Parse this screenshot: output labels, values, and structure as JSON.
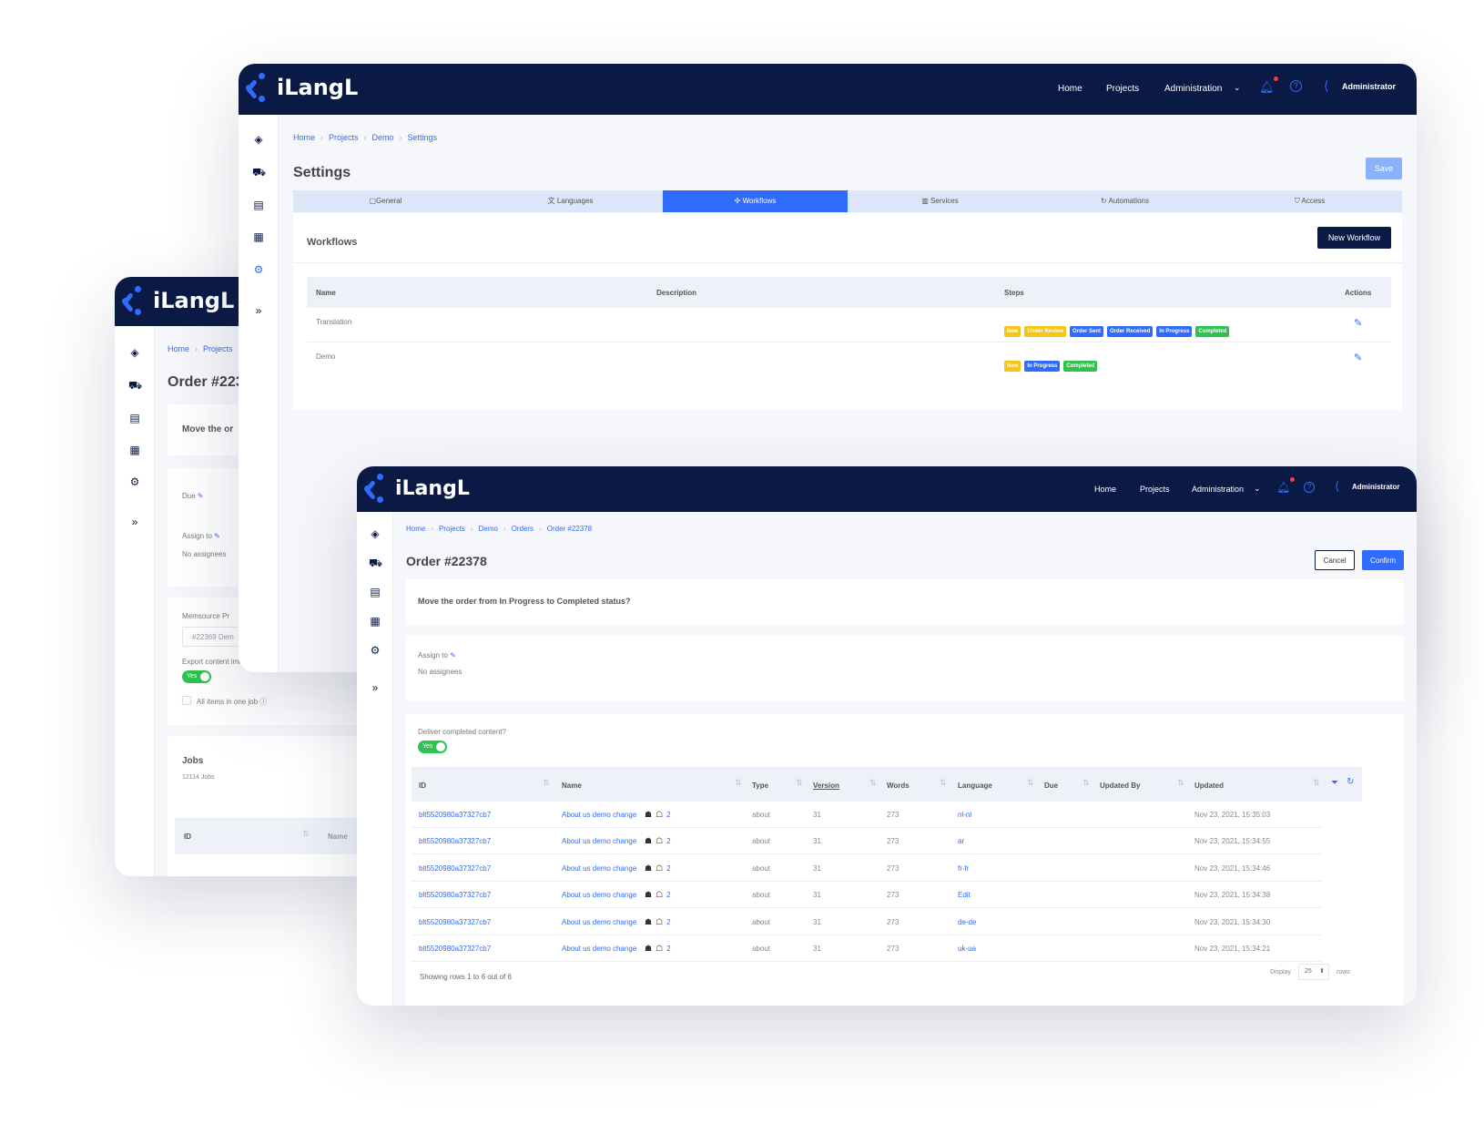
{
  "brand": "iLangL",
  "nav": {
    "home": "Home",
    "projects": "Projects",
    "administration": "Administration",
    "user": "Administrator"
  },
  "back_window": {
    "breadcrumb": [
      "Home",
      "Projects"
    ],
    "title": "Order #223",
    "move_text": "Move the or",
    "due_label": "Due",
    "assign_label": "Assign to",
    "no_assignees": "No assignees",
    "memsource_label": "Memsource Pr",
    "memsource_value": "#22369 Dem",
    "export_label": "Export content immediately",
    "toggle_label": "Yes",
    "all_items_label": "All items in one job",
    "jobs_title": "Jobs",
    "jobs_count": "12114 Jobs",
    "col_id": "ID",
    "col_name": "Name"
  },
  "settings_window": {
    "breadcrumb": [
      "Home",
      "Projects",
      "Demo",
      "Settings"
    ],
    "title": "Settings",
    "save_label": "Save",
    "tabs": [
      "General",
      "Languages",
      "Workflows",
      "Services",
      "Automations",
      "Access"
    ],
    "active_tab": "Workflows",
    "section_title": "Workflows",
    "new_workflow_label": "New Workflow",
    "columns": [
      "Name",
      "Description",
      "Steps",
      "Actions"
    ],
    "rows": [
      {
        "name": "Translation",
        "description": "",
        "steps": [
          {
            "label": "New",
            "color": "#f5c518"
          },
          {
            "label": "Under Review",
            "color": "#f5c518"
          },
          {
            "label": "Order Sent",
            "color": "#2f6bff"
          },
          {
            "label": "Order Received",
            "color": "#2f6bff"
          },
          {
            "label": "In Progress",
            "color": "#2f6bff"
          },
          {
            "label": "Completed",
            "color": "#2ec34e"
          }
        ]
      },
      {
        "name": "Demo",
        "description": "",
        "steps": [
          {
            "label": "New",
            "color": "#f5c518"
          },
          {
            "label": "In Progress",
            "color": "#2f6bff"
          },
          {
            "label": "Completed",
            "color": "#2ec34e"
          }
        ]
      }
    ]
  },
  "order_window": {
    "breadcrumb": [
      "Home",
      "Projects",
      "Demo",
      "Orders",
      "Order #22378"
    ],
    "title": "Order #22378",
    "cancel_label": "Cancel",
    "confirm_label": "Confirm",
    "question": "Move the order from In Progress to Completed status?",
    "assign_label": "Assign to",
    "no_assignees": "No assignees",
    "deliver_label": "Deliver completed content?",
    "toggle_label": "Yes",
    "columns": [
      "ID",
      "Name",
      "Type",
      "Version",
      "Words",
      "Language",
      "Due",
      "Updated By",
      "Updated"
    ],
    "rows": [
      {
        "id": "blt5520980a37327cb7",
        "name": "About us demo change",
        "count": "2",
        "type": "about",
        "version": "31",
        "words": "273",
        "language": "nl-nl",
        "due": "",
        "updated_by": "",
        "updated": "Nov 23, 2021, 15:35:03"
      },
      {
        "id": "blt5520980a37327cb7",
        "name": "About us demo change",
        "count": "2",
        "type": "about",
        "version": "31",
        "words": "273",
        "language": "ar",
        "due": "",
        "updated_by": "",
        "updated": "Nov 23, 2021, 15:34:55"
      },
      {
        "id": "blt5520980a37327cb7",
        "name": "About us demo change",
        "count": "2",
        "type": "about",
        "version": "31",
        "words": "273",
        "language": "fr-fr",
        "due": "",
        "updated_by": "",
        "updated": "Nov 23, 2021, 15:34:46"
      },
      {
        "id": "blt5520980a37327cb7",
        "name": "About us demo change",
        "count": "2",
        "type": "about",
        "version": "31",
        "words": "273",
        "language": "Edit",
        "due": "",
        "updated_by": "",
        "updated": "Nov 23, 2021, 15:34:38"
      },
      {
        "id": "blt5520980a37327cb7",
        "name": "About us demo change",
        "count": "2",
        "type": "about",
        "version": "31",
        "words": "273",
        "language": "de-de",
        "due": "",
        "updated_by": "",
        "updated": "Nov 23, 2021, 15:34:30"
      },
      {
        "id": "blt5520980a37327cb7",
        "name": "About us demo change",
        "count": "2",
        "type": "about",
        "version": "31",
        "words": "273",
        "language": "uk-ua",
        "due": "",
        "updated_by": "",
        "updated": "Nov 23, 2021, 15:34:21"
      }
    ],
    "footer_text": "Showing rows 1 to 6 out of 6",
    "display_label": "Display",
    "page_size": "25",
    "rows_label": "rows"
  },
  "colors": {
    "navy": "#0b1a45",
    "accent": "#2f6bff",
    "yellow": "#f5c518",
    "green": "#2ec34e"
  }
}
